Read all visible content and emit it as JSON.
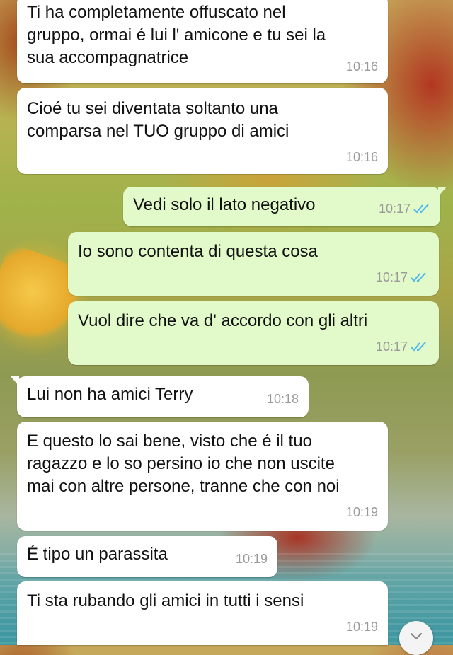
{
  "chat": {
    "messages": [
      {
        "direction": "in",
        "text": "Ti ha completamente offuscato nel\ngruppo, ormai é lui l' amicone e tu sei la\nsua accompagnatrice",
        "time": "10:16"
      },
      {
        "direction": "in",
        "text": "Cioé tu sei diventata soltanto una\ncomparsa nel TUO gruppo di amici",
        "time": "10:16"
      },
      {
        "direction": "out",
        "text": "Vedi solo il lato negativo",
        "time": "10:17",
        "status": "read"
      },
      {
        "direction": "out",
        "text": "Io sono contenta di questa cosa",
        "time": "10:17",
        "status": "read"
      },
      {
        "direction": "out",
        "text": "Vuol dire che va d' accordo con gli altri",
        "time": "10:17",
        "status": "read"
      },
      {
        "direction": "in",
        "text": "Lui non ha amici Terry",
        "time": "10:18"
      },
      {
        "direction": "in",
        "text": "E questo lo sai bene, visto che é il tuo\nragazzo e lo so persino io che non uscite\nmai con altre persone, tranne che con noi",
        "time": "10:19"
      },
      {
        "direction": "in",
        "text": "É tipo un parassita",
        "time": "10:19"
      },
      {
        "direction": "in",
        "text": "Ti sta rubando gli amici in tutti i sensi",
        "time": "10:19"
      }
    ]
  },
  "colors": {
    "incoming_bubble": "#ffffff",
    "outgoing_bubble": "#e2fac9",
    "read_ticks": "#4fb6ec"
  },
  "icons": {
    "read_receipt": "double-check-icon",
    "scroll_down": "chevron-down-icon"
  }
}
